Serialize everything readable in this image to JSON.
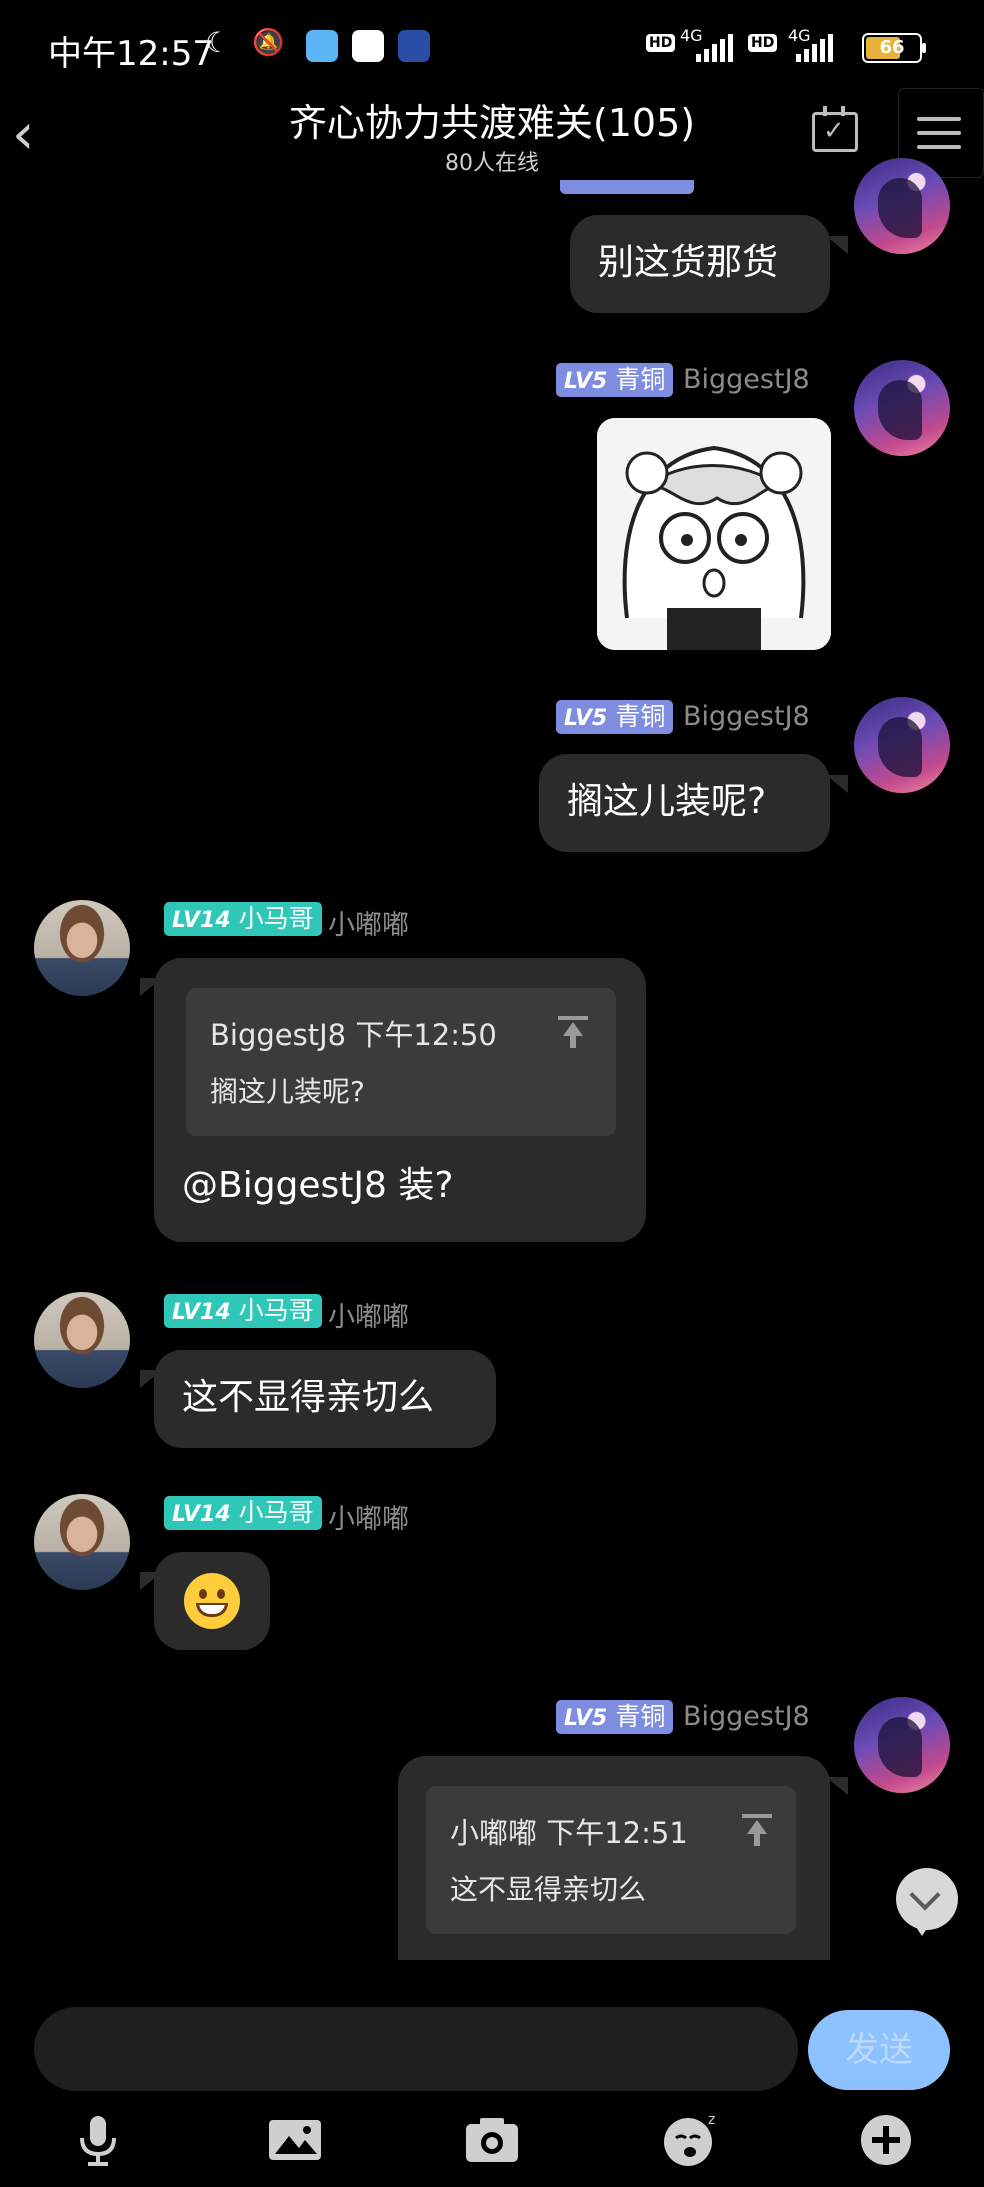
{
  "status_bar": {
    "time": "中午12:57",
    "network1": "4G",
    "network2": "4G",
    "hd": "HD",
    "battery": "66"
  },
  "header": {
    "title": "齐心协力共渡难关(105)",
    "online": "80人在线"
  },
  "messages": [
    {
      "sender": "me",
      "text": "别这货那货"
    },
    {
      "sender": "me",
      "level": "LV5",
      "rank": "青铜",
      "name": "BiggestJ8",
      "sticker": "anime-girl-sticker"
    },
    {
      "sender": "me",
      "level": "LV5",
      "rank": "青铜",
      "name": "BiggestJ8",
      "text": "搁这儿装呢?"
    },
    {
      "sender": "other",
      "level": "LV14",
      "rank": "小马哥",
      "name": "小嘟嘟",
      "quote_name": "BiggestJ8",
      "quote_time": "下午12:50",
      "quote_text": "搁这儿装呢?",
      "text": "@BiggestJ8 装?"
    },
    {
      "sender": "other",
      "level": "LV14",
      "rank": "小马哥",
      "name": "小嘟嘟",
      "text": "这不显得亲切么"
    },
    {
      "sender": "other",
      "level": "LV14",
      "rank": "小马哥",
      "name": "小嘟嘟",
      "emoji": "grinning-face"
    },
    {
      "sender": "me",
      "level": "LV5",
      "rank": "青铜",
      "name": "BiggestJ8",
      "quote_name": "小嘟嘟",
      "quote_time": "下午12:51",
      "quote_text": "这不显得亲切么"
    }
  ],
  "input": {
    "send_label": "发送"
  },
  "toolbar": [
    "microphone-icon",
    "image-icon",
    "camera-icon",
    "emoji-icon",
    "plus-icon"
  ]
}
